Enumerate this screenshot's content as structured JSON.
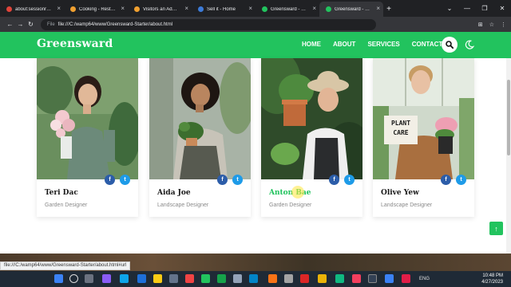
{
  "browser": {
    "tabs": [
      {
        "title": "about:sessionrestore",
        "favicon_color": "#e0443a",
        "active": false
      },
      {
        "title": "Cooking - Restaurants Cafe",
        "favicon_color": "#f0a030",
        "active": false
      },
      {
        "title": "Visitors an Admin Panel Cafe",
        "favicon_color": "#f0a030",
        "active": false
      },
      {
        "title": "Sell it - Home",
        "favicon_color": "#3c7bd8",
        "active": false
      },
      {
        "title": "Greensward - Gardening",
        "favicon_color": "#22c35e",
        "active": false
      },
      {
        "title": "Greensward - Gardening",
        "favicon_color": "#22c35e",
        "active": true
      }
    ],
    "new_tab_glyph": "+",
    "window_controls": [
      "⌄",
      "—",
      "❐",
      "✕"
    ],
    "back_icon": "←",
    "forward_icon": "→",
    "reload_icon": "↻",
    "address_prefix": "File",
    "address": "file:///C:/wamp64/www/Greensward-Starter/about.html",
    "toolbar_icons": [
      "⊞",
      "☆",
      "⋮"
    ]
  },
  "site": {
    "logo": "Greensward",
    "nav": [
      "HOME",
      "ABOUT",
      "SERVICES",
      "CONTACT"
    ],
    "brand_color": "#22c35e"
  },
  "team": [
    {
      "name": "Teri Dac",
      "role": "Garden Designer",
      "hovered": false
    },
    {
      "name": "Aida Joe",
      "role": "Landscape Designer",
      "hovered": false
    },
    {
      "name": "Anton Bae",
      "role": "Garden Designer",
      "hovered": true
    },
    {
      "name": "Olive Yew",
      "role": "Landscape Designer",
      "hovered": false
    }
  ],
  "social": {
    "facebook": "f",
    "twitter": "t"
  },
  "photo_sign": [
    "PLANT",
    "CARE"
  ],
  "back_to_top": "↑",
  "status_url": "file:///C:/wamp64/www/Greensward-Starter/about.html#url",
  "taskbar": {
    "tray_language": "ENG",
    "time": "10:48 PM",
    "date": "4/27/2023"
  }
}
